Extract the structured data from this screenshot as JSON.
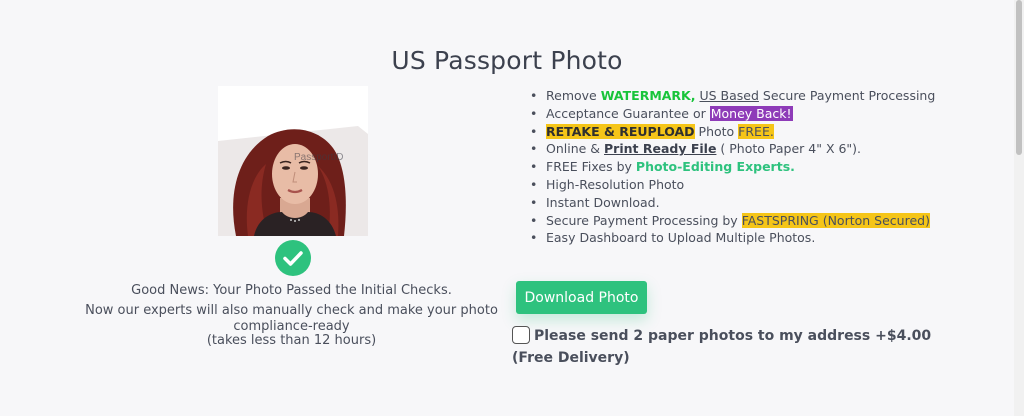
{
  "page_title": "US Passport Photo",
  "photo": {
    "watermark": "PassportID"
  },
  "status": {
    "good_news": "Good News: Your Photo Passed the Initial Checks.",
    "experts_line": "Now our experts will also manually check and make your photo compliance-ready",
    "hours_line": "(takes less than 12 hours)"
  },
  "features": {
    "f1": {
      "pre": "Remove ",
      "wm": "WATERMARK,",
      "us": "US Based",
      "post": " Secure Payment Processing"
    },
    "f2": {
      "pre": "Acceptance Guarantee or ",
      "money": "Money Back!"
    },
    "f3": {
      "retake": "RETAKE & REUPLOAD",
      "mid": " Photo ",
      "free": "FREE."
    },
    "f4": {
      "pre": "Online & ",
      "print": "Print Ready File",
      "post": " ( Photo Paper 4\" X 6\")."
    },
    "f5": {
      "pre": "FREE Fixes by ",
      "experts": "Photo-Editing Experts."
    },
    "f6": "High-Resolution Photo",
    "f7": "Instant Download.",
    "f8": {
      "pre": "Secure Payment Processing by ",
      "fastspring": "FASTSPRING (Norton Secured)"
    },
    "f9": "Easy Dashboard to Upload Multiple Photos."
  },
  "download_label": "Download Photo",
  "paper_option": {
    "label": "Please send 2 paper photos to my address +$4.00 (Free Delivery)",
    "checked": false
  },
  "colors": {
    "accent_green": "#2ec27e",
    "highlight_yellow": "#f5c518",
    "money_purple": "#8e3bb8",
    "watermark_green": "#18c43a"
  },
  "icons": {
    "status": "check-circle-icon"
  }
}
